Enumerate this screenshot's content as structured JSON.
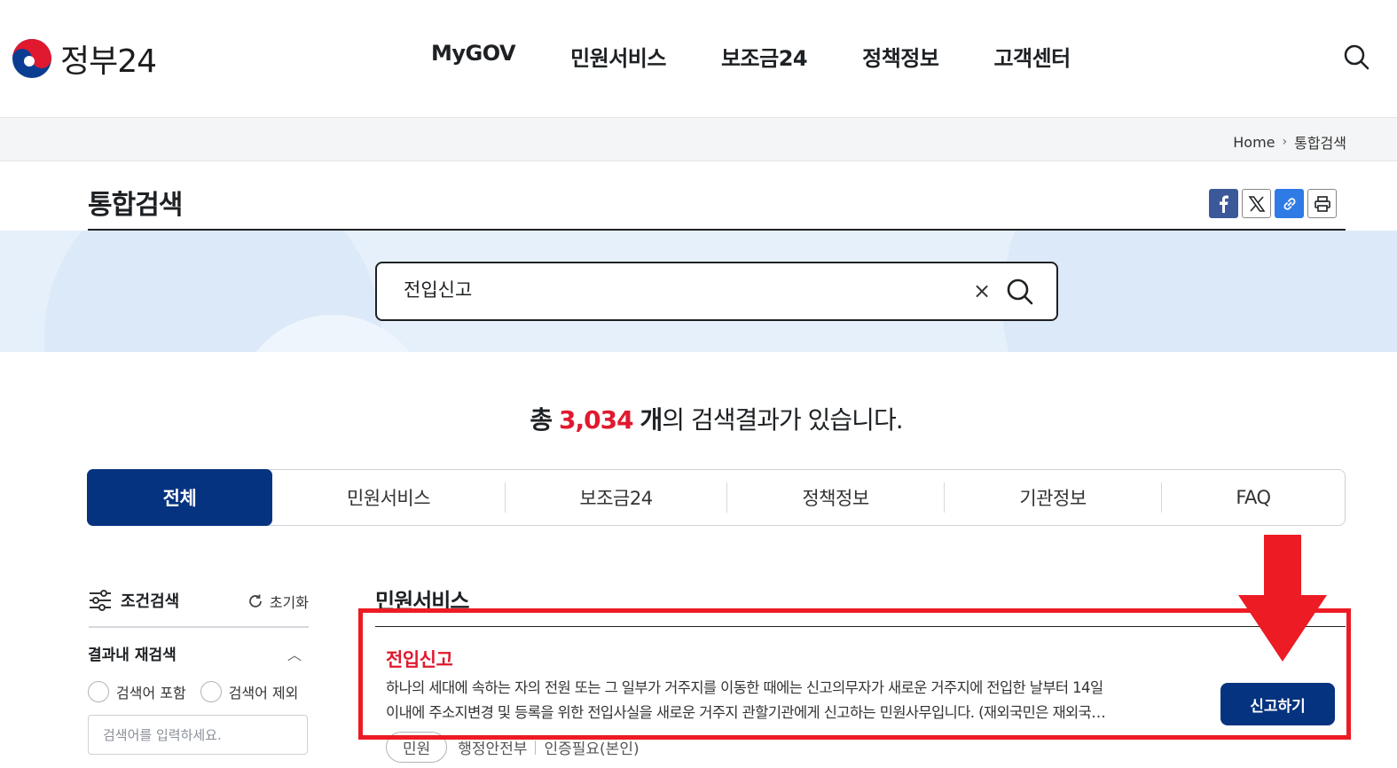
{
  "header": {
    "logo_text": "정부24",
    "nav": [
      "MyGOV",
      "민원서비스",
      "보조금24",
      "정책정보",
      "고객센터"
    ]
  },
  "breadcrumb": {
    "home": "Home",
    "current": "통합검색"
  },
  "page": {
    "title": "통합검색"
  },
  "search": {
    "value": "전입신고",
    "clear_label": "×"
  },
  "results": {
    "prefix": "총",
    "count": "3,034",
    "unit": "개",
    "suffix": "의 검색결과가 있습니다."
  },
  "tabs": [
    "전체",
    "민원서비스",
    "보조금24",
    "정책정보",
    "기관정보",
    "FAQ"
  ],
  "filter": {
    "title": "조건검색",
    "reset": "초기화",
    "refine_title": "결과내 재검색",
    "include": "검색어 포함",
    "exclude": "검색어 제외",
    "placeholder": "검색어를 입력하세요."
  },
  "section": {
    "title": "민원서비스",
    "item": {
      "title": "전입신고",
      "desc_line1": "하나의 세대에 속하는 자의 전원 또는 그 일부가 거주지를 이동한 때에는 신고의무자가 새로운 거주지에 전입한 날부터 14일",
      "desc_line2": "이내에 주소지변경 및 등록을 위한 전입사실을 새로운 거주지 관할기관에게 신고하는 민원사무입니다. (재외국민은 재외국…",
      "button": "신고하기",
      "tag": "민원",
      "org": "행정안전부",
      "auth": "인증필요(본인)"
    }
  },
  "colors": {
    "brand_navy": "#063380",
    "highlight_red": "#e0192f",
    "annotation_red": "#ec1b24"
  }
}
